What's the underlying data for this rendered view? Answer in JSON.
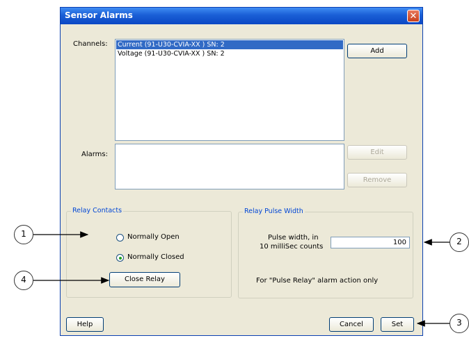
{
  "window": {
    "title": "Sensor Alarms",
    "close_symbol": "✕"
  },
  "channels": {
    "label": "Channels:",
    "items": [
      {
        "text": "Current (91-U30-CVIA-XX ) SN: 2",
        "selected": true
      },
      {
        "text": "Voltage (91-U30-CVIA-XX ) SN: 2",
        "selected": false
      }
    ],
    "add_label": "Add"
  },
  "alarms": {
    "label": "Alarms:",
    "edit_label": "Edit",
    "remove_label": "Remove"
  },
  "relay_contacts": {
    "title": "Relay Contacts",
    "normally_open": "Normally Open",
    "normally_closed": "Normally Closed",
    "selected": "normally_closed",
    "close_relay_label": "Close Relay"
  },
  "relay_pulse": {
    "title": "Relay Pulse Width",
    "label_line1": "Pulse width, in",
    "label_line2": "10 milliSec counts",
    "value": "100",
    "note": "For \"Pulse Relay\" alarm action only"
  },
  "footer": {
    "help_label": "Help",
    "cancel_label": "Cancel",
    "set_label": "Set"
  },
  "callouts": {
    "c1": "1",
    "c2": "2",
    "c3": "3",
    "c4": "4"
  },
  "colors": {
    "titlebar": "#1a5fd6",
    "selection": "#316ac5",
    "group_title": "#0046d5"
  }
}
